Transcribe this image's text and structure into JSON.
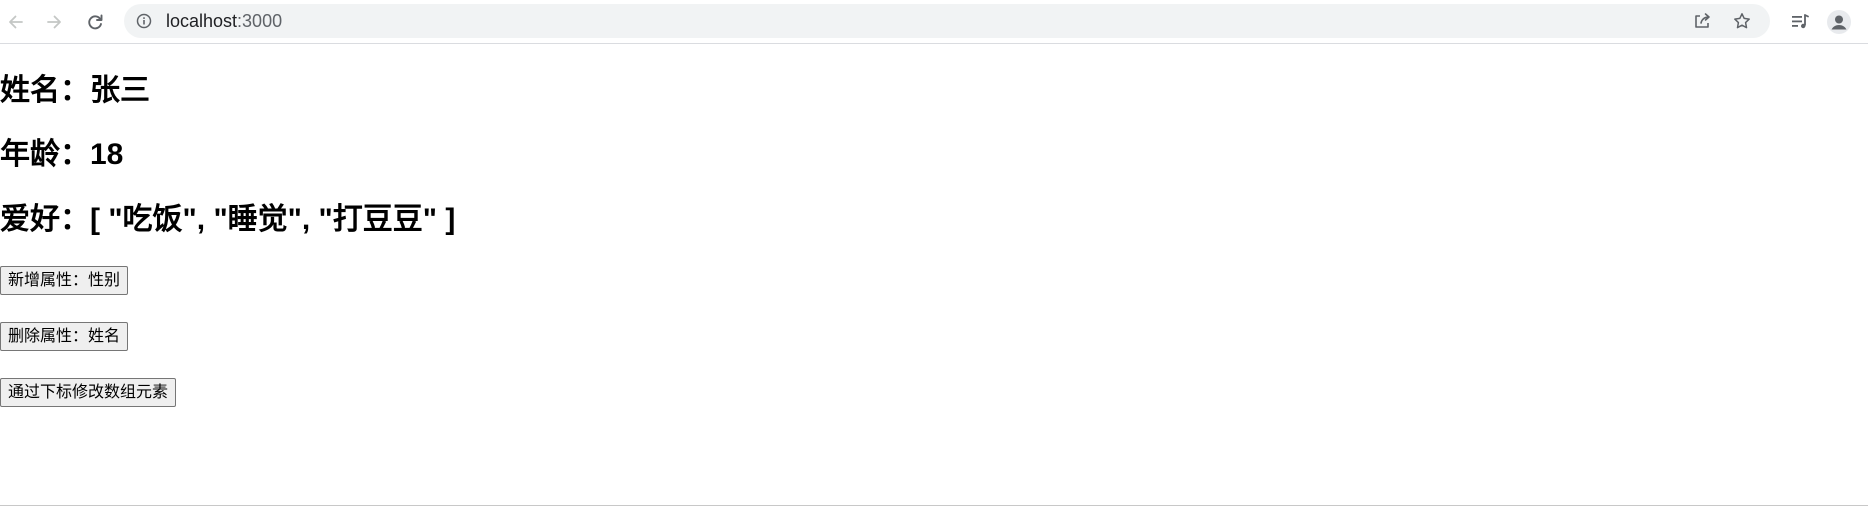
{
  "browser": {
    "url_host": "localhost",
    "url_port": ":3000",
    "icons": {
      "back": "arrow-left-icon",
      "forward": "arrow-right-icon",
      "reload": "reload-icon",
      "site_info": "info-icon",
      "share": "share-icon",
      "bookmark": "star-icon",
      "media": "media-queue-icon",
      "profile": "profile-icon"
    },
    "colors": {
      "omnibox_bg": "#f1f3f4",
      "icon_active": "#5f6368",
      "icon_disabled": "#c4c7c5"
    }
  },
  "person": {
    "name_line": "姓名：张三",
    "age_line": "年龄：18",
    "hobby_line": "爱好：[ \"吃饭\", \"睡觉\", \"打豆豆\" ]"
  },
  "buttons": {
    "add_sex": "新增属性：性别",
    "delete_name": "删除属性：姓名",
    "modify_by_index": "通过下标修改数组元素"
  }
}
